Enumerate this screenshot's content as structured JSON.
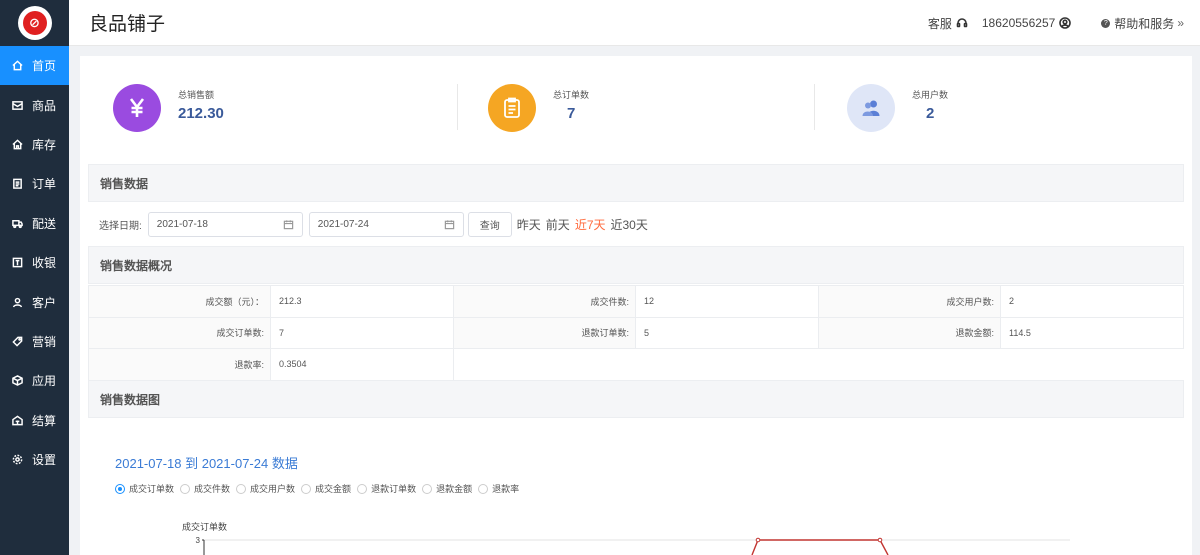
{
  "header": {
    "shop_title": "良品铺子",
    "service_label": "客服",
    "phone": "18620556257",
    "help_label": "帮助和服务"
  },
  "sidebar": {
    "items": [
      {
        "label": "首页",
        "icon": "home-icon"
      },
      {
        "label": "商品",
        "icon": "goods-icon"
      },
      {
        "label": "库存",
        "icon": "stock-icon"
      },
      {
        "label": "订单",
        "icon": "order-icon"
      },
      {
        "label": "配送",
        "icon": "truck-icon"
      },
      {
        "label": "收银",
        "icon": "cashier-icon"
      },
      {
        "label": "客户",
        "icon": "user-icon"
      },
      {
        "label": "营销",
        "icon": "tag-icon"
      },
      {
        "label": "应用",
        "icon": "cube-icon"
      },
      {
        "label": "结算",
        "icon": "settle-icon"
      },
      {
        "label": "设置",
        "icon": "gear-icon"
      }
    ]
  },
  "stats": {
    "sales": {
      "label": "总销售额",
      "value": "212.30",
      "color": "#9a4be0"
    },
    "orders": {
      "label": "总订单数",
      "value": "7",
      "color": "#f5a623"
    },
    "users": {
      "label": "总用户数",
      "value": "2",
      "color": "#dfe6f7"
    }
  },
  "sales_data": {
    "title": "销售数据",
    "date_label": "选择日期:",
    "start_date": "2021-07-18",
    "end_date": "2021-07-24",
    "query_label": "查询",
    "quick": [
      "昨天",
      "前天",
      "近7天",
      "近30天"
    ]
  },
  "overview": {
    "title": "销售数据概况",
    "rows": [
      [
        {
          "k": "成交额（元）：",
          "v": "212.3"
        },
        {
          "k": "成交件数:",
          "v": "12"
        },
        {
          "k": "成交用户数:",
          "v": "2"
        }
      ],
      [
        {
          "k": "成交订单数:",
          "v": "7"
        },
        {
          "k": "退款订单数:",
          "v": "5"
        },
        {
          "k": "退款金额:",
          "v": "114.5"
        }
      ],
      [
        {
          "k": "退款率:",
          "v": "0.3504"
        }
      ]
    ]
  },
  "chart_section": {
    "title": "销售数据图",
    "chart_title": "2021-07-18 到 2021-07-24 数据",
    "legend": [
      "成交订单数",
      "成交件数",
      "成交用户数",
      "成交金额",
      "退款订单数",
      "退款金额",
      "退款率"
    ]
  },
  "chart_data": {
    "type": "line",
    "title": "2021-07-18 到 2021-07-24 数据",
    "ylabel": "成交订单数",
    "series": [
      {
        "name": "成交订单数",
        "color": "#c23531"
      }
    ],
    "visible_y_ticks": [
      "3"
    ],
    "grid": true
  }
}
